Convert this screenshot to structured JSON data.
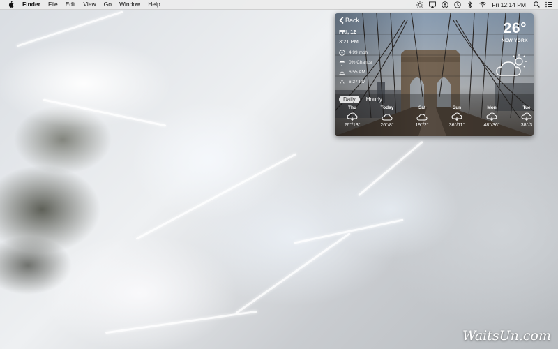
{
  "menubar": {
    "app_name": "Finder",
    "menus": [
      "File",
      "Edit",
      "View",
      "Go",
      "Window",
      "Help"
    ],
    "clock": "Fri 12:14 PM"
  },
  "weather": {
    "back_label": "Back",
    "date": "FRI, 12",
    "time": "3:21 PM",
    "wind": "4.99 mph",
    "precip": "0% Chance",
    "sunrise": "6:55 AM",
    "sunset": "6:27 PM",
    "temperature": "26°",
    "city": "NEW YORK",
    "current_icon": "partly-cloudy-icon",
    "tabs": {
      "daily": "Daily",
      "hourly": "Hourly"
    },
    "forecast": [
      {
        "day": "Thu",
        "range": "26°/13°",
        "icon": "rain-cloud-icon"
      },
      {
        "day": "Today",
        "range": "26°/8°",
        "icon": "cloud-icon"
      },
      {
        "day": "Sat",
        "range": "19°/2°",
        "icon": "cloud-icon"
      },
      {
        "day": "Sun",
        "range": "36°/11°",
        "icon": "rain-cloud-icon"
      },
      {
        "day": "Mon",
        "range": "48°/36°",
        "icon": "rain-cloud-icon"
      },
      {
        "day": "Tue",
        "range": "38°/3",
        "icon": "rain-cloud-icon"
      }
    ]
  },
  "watermark": "WaitsUn.com"
}
